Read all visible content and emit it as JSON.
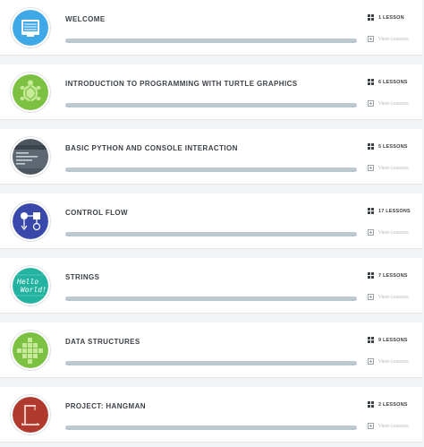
{
  "modules": [
    {
      "title": "WELCOME",
      "lessons": "1 LESSON",
      "view": "View Lessons",
      "icon": "monitor-icon",
      "color": "#3fa9e8",
      "progress": 0
    },
    {
      "title": "INTRODUCTION TO PROGRAMMING WITH TURTLE GRAPHICS",
      "lessons": "6 LESSONS",
      "view": "View Lessons",
      "icon": "turtle-icon",
      "color": "#7cc142",
      "progress": 0
    },
    {
      "title": "BASIC PYTHON AND CONSOLE INTERACTION",
      "lessons": "5 LESSONS",
      "view": "View Lessons",
      "icon": "console-icon",
      "color": "#4a5560",
      "progress": 0
    },
    {
      "title": "CONTROL FLOW",
      "lessons": "17 LESSONS",
      "view": "View Lessons",
      "icon": "flowchart-icon",
      "color": "#3949ab",
      "progress": 0
    },
    {
      "title": "STRINGS",
      "lessons": "7 LESSONS",
      "view": "View Lessons",
      "icon": "hello-world-icon",
      "color": "#24b3a1",
      "icon_text_1": "Hello",
      "icon_text_2": "World!",
      "progress": 0
    },
    {
      "title": "DATA STRUCTURES",
      "lessons": "9 LESSONS",
      "view": "View Lessons",
      "icon": "grid-blocks-icon",
      "color": "#7cc142",
      "progress": 0
    },
    {
      "title": "PROJECT: HANGMAN",
      "lessons": "2 LESSONS",
      "view": "View Lessons",
      "icon": "gallows-icon",
      "color": "#b13a2e",
      "progress": 0
    }
  ]
}
